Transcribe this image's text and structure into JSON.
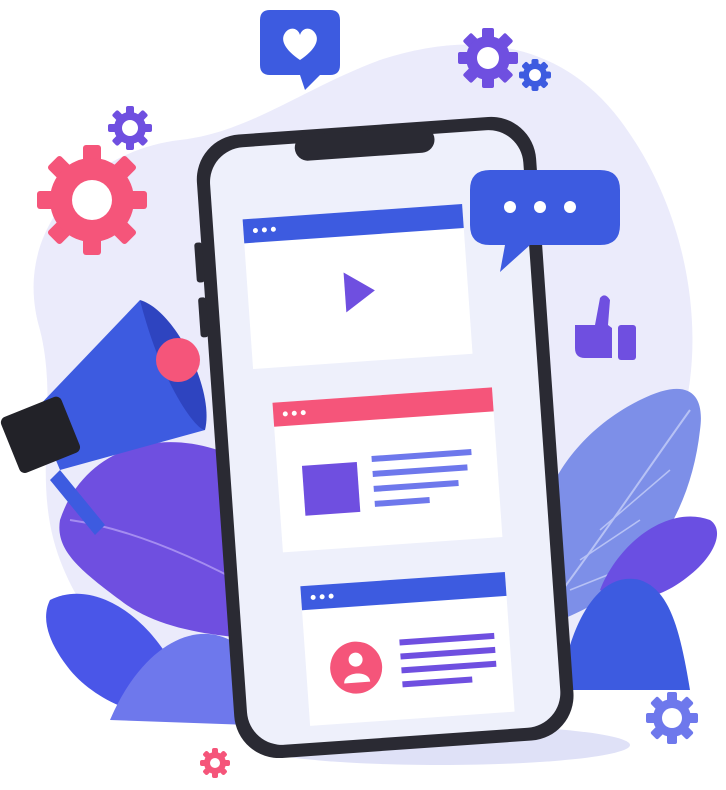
{
  "illustration": {
    "subject": "social-media-marketing-phone",
    "colors": {
      "background_blob": "#ebebfb",
      "phone_frame": "#2a2a33",
      "phone_screen": "#eef0fb",
      "card_fill": "#ffffff",
      "blue": "#3d5be0",
      "pink": "#f5557a",
      "purple": "#7b56e2",
      "dark": "#222228",
      "light_blue": "#7d8fe8"
    },
    "icons": [
      "heart-icon",
      "gear-icon",
      "chat-bubble-icon",
      "thumbs-up-icon",
      "megaphone-icon",
      "play-icon",
      "user-icon",
      "leaf-icon"
    ],
    "cards": [
      {
        "header_color": "blue",
        "content": "video"
      },
      {
        "header_color": "pink",
        "content": "image-with-text"
      },
      {
        "header_color": "blue",
        "content": "profile-with-text"
      }
    ]
  }
}
